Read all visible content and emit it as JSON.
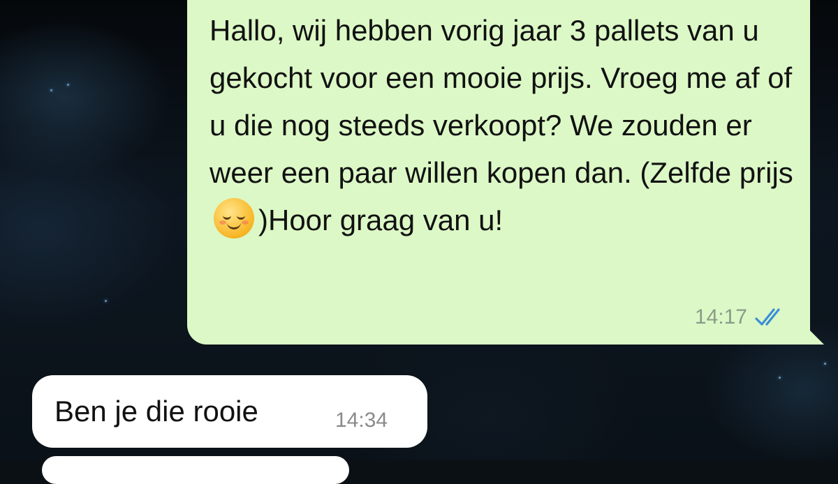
{
  "messages": [
    {
      "direction": "outgoing",
      "text_before_emoji": "Hallo, wij hebben vorig jaar 3 pallets van u gekocht voor een mooie prijs. Vroeg me af of u die nog steeds verkoopt? We zouden er weer een paar willen kopen dan. (Zelfde prijs ",
      "emoji": "smiling-face-emoji",
      "text_after_emoji": ")Hoor graag van u!",
      "time": "14:17",
      "status_icon": "double-check-read-icon",
      "bubble_color": "#dcf8c6"
    },
    {
      "direction": "incoming",
      "text": "Ben je die rooie",
      "time": "14:34",
      "bubble_color": "#ffffff"
    }
  ],
  "colors": {
    "read_tick": "#3a8fd6",
    "outgoing_bubble": "#dcf8c6",
    "incoming_bubble": "#ffffff"
  }
}
